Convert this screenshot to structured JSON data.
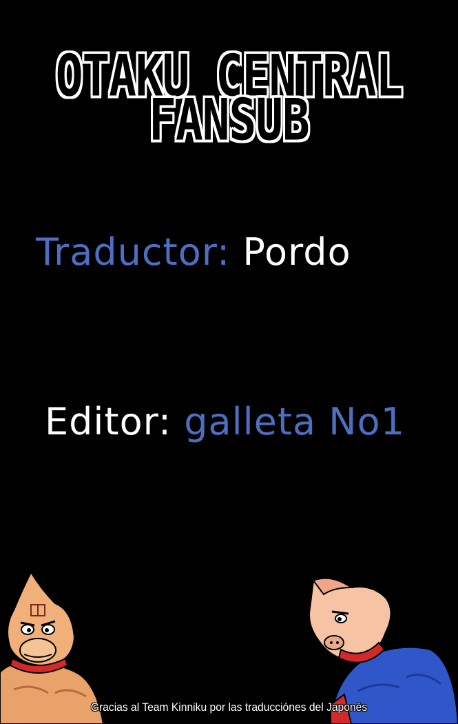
{
  "header": {
    "title_line_1": "OTAKU CENTRAL",
    "title_line_2": "FANSUB"
  },
  "credits": {
    "translator_label": "Traductor:",
    "translator_name": "Pordo",
    "editor_label": "Editor:",
    "editor_name": "galleta No1"
  },
  "illustrations": {
    "left_character_icon": "muscle-hero-character-icon",
    "right_character_icon": "blue-suit-hero-character-icon"
  },
  "footer": {
    "thanks_text": "Gracias al Team Kinniku por las traducciónes del Japonés"
  },
  "colors": {
    "background": "#000000",
    "accent_blue": "#4d6fc2",
    "text_white": "#ffffff"
  }
}
